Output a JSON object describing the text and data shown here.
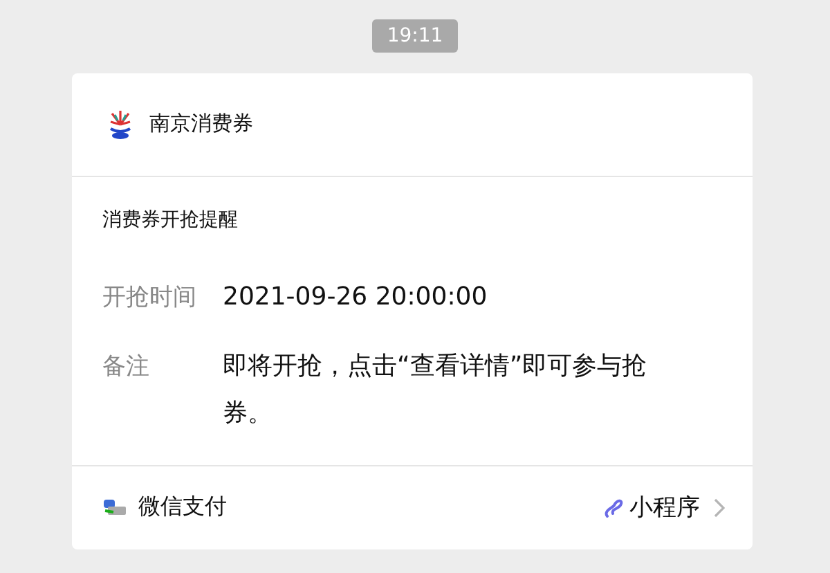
{
  "timestamp": "19:11",
  "card": {
    "account": "南京消费券",
    "title": "消费券开抢提醒",
    "fields": [
      {
        "label": "开抢时间",
        "value": "2021-09-26 20:00:00"
      },
      {
        "label": "备注",
        "value": "即将开抢，点击“查看详情”即可参与抢券。"
      }
    ],
    "footer": {
      "source": "微信支付",
      "link": "小程序"
    }
  }
}
